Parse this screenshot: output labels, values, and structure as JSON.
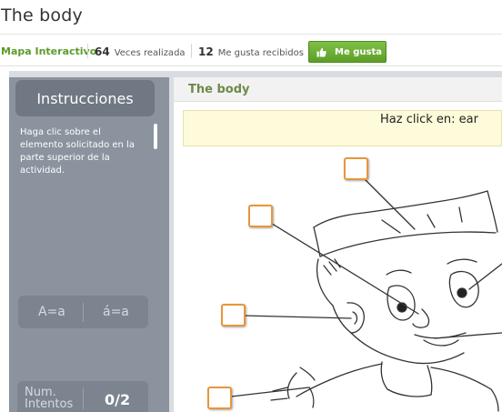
{
  "header": {
    "title": "The body"
  },
  "meta": {
    "type": "Mapa Interactivo",
    "plays_count": "64",
    "plays_label": "Veces realizada",
    "likes_count": "12",
    "likes_label": "Me gusta recibidos",
    "like_button": "Me gusta"
  },
  "sidebar": {
    "instructions_label": "Instrucciones",
    "instructions_text": "Haga clic sobre el elemento solicitado en la parte superior de la actividad.",
    "case_toggle": "A=a",
    "accent_toggle": "á=a",
    "attempts_label": "Num. Intentos",
    "attempts_value": "0/2"
  },
  "activity": {
    "title": "The body",
    "prompt": "Haz click en: ear"
  },
  "colors": {
    "brand_green": "#5c9b2c",
    "hotspot_border": "#e8953a",
    "sidebar": "#8a939e"
  }
}
